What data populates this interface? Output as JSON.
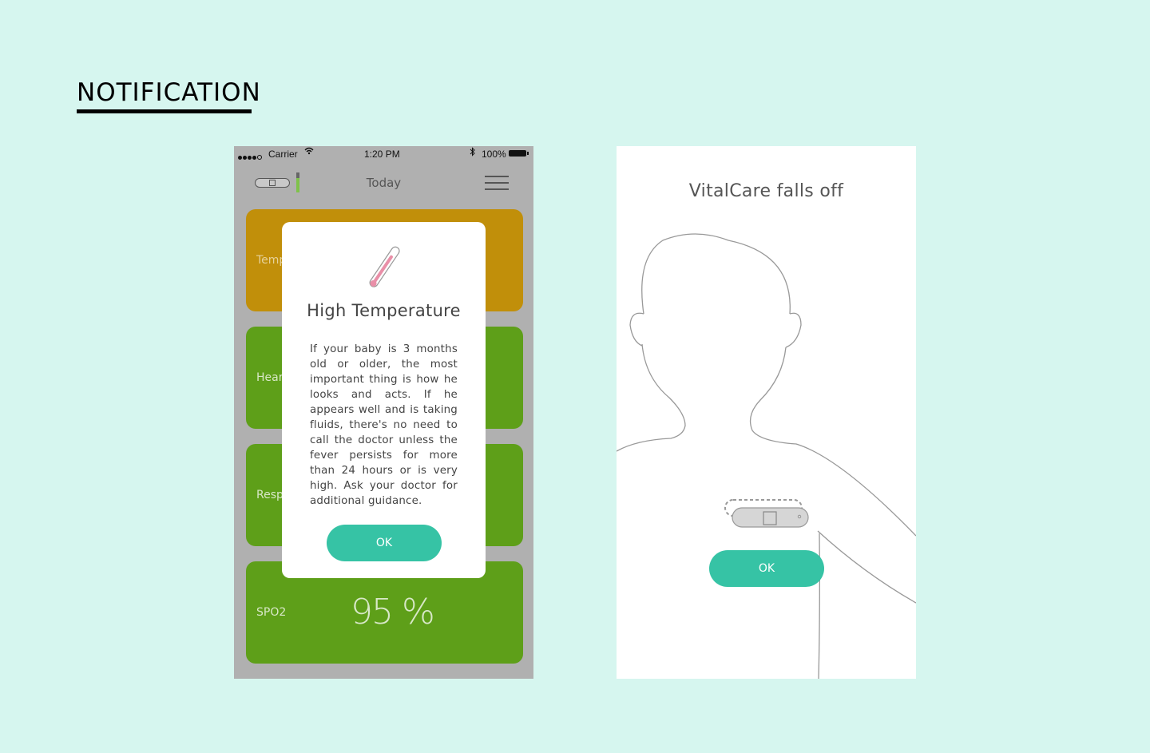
{
  "page": {
    "title": "NOTIFICATION"
  },
  "phone": {
    "status": {
      "carrier": "Carrier",
      "time": "1:20 PM",
      "battery": "100%"
    },
    "nav": {
      "title": "Today"
    },
    "cards": [
      {
        "label": "Temp",
        "color": "#c18f0a"
      },
      {
        "label": "Hear",
        "color": "#5e9f19"
      },
      {
        "label": "Resp",
        "color": "#5e9f19"
      },
      {
        "label": "SPO2",
        "value": "95 %",
        "color": "#5e9f19"
      }
    ],
    "modal": {
      "icon": "thermometer-icon",
      "title": "High Temperature",
      "body": "If your baby is 3 months old or older, the most important thing is how he looks and acts. If he appears well and is taking fluids, there's no need to call the doctor unless the fever persists for more than 24 hours or is very high. Ask your doctor for additional guidance.",
      "ok_label": "OK"
    }
  },
  "falloff": {
    "title": "VitalCare falls off",
    "ok_label": "OK"
  },
  "colors": {
    "background": "#d6f6ef",
    "accent": "#36c3a5",
    "warning": "#c18f0a",
    "normal": "#5e9f19"
  }
}
